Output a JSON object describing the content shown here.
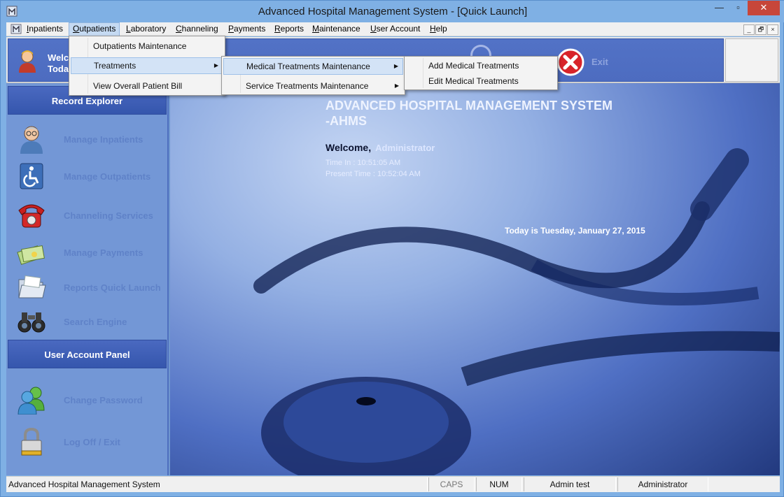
{
  "window": {
    "title": "Advanced Hospital Management System - [Quick Launch]",
    "controls": {
      "minimize": "—",
      "maximize": "▫",
      "close": "✕"
    }
  },
  "menubar": {
    "items": [
      {
        "label": "Inpatients",
        "accel": "I",
        "rest": "npatients"
      },
      {
        "label": "Outpatients",
        "accel": "O",
        "rest": "utpatients"
      },
      {
        "label": "Laboratory",
        "accel": "L",
        "rest": "aboratory"
      },
      {
        "label": "Channeling",
        "accel": "C",
        "rest": "hanneling"
      },
      {
        "label": "Payments",
        "accel": "P",
        "rest": "ayments"
      },
      {
        "label": "Reports",
        "accel": "R",
        "rest": "eports"
      },
      {
        "label": "Maintenance",
        "accel": "M",
        "rest": "aintenance"
      },
      {
        "label": "User Account",
        "accel": "U",
        "rest": "ser Account"
      },
      {
        "label": "Help",
        "accel": "H",
        "rest": "elp"
      }
    ],
    "mdi_controls": [
      "_",
      "🗗",
      "×"
    ]
  },
  "header": {
    "welcome_short_1": "Welco",
    "welcome_short_2": "Toda",
    "exit_label": "Exit"
  },
  "dropdowns": {
    "outpatients": [
      "Outpatients Maintenance",
      "Treatments",
      "View Overall Patient Bill"
    ],
    "treatments": [
      "Medical Treatments Maintenance",
      "Service Treatments Maintenance"
    ],
    "medical": [
      "Add Medical Treatments",
      "Edit Medical Treatments"
    ],
    "arrow": "▶"
  },
  "sidebar": {
    "record_heading": "Record Explorer",
    "record_items": [
      "Manage Inpatients",
      "Manage Outpatients",
      "Channeling Services",
      "Manage Payments",
      "Reports Quick Launch",
      "Search Engine"
    ],
    "account_heading": "User Account Panel",
    "account_items": [
      "Change Password",
      "Log Off / Exit"
    ]
  },
  "main": {
    "title_line1": "ADVANCED HOSPITAL MANAGEMENT SYSTEM",
    "title_line2": " -AHMS",
    "welcome_label": "Welcome,",
    "welcome_user": "Administrator",
    "time_in": "Time In :   10:51:05 AM",
    "present_time": "Present Time :  10:52:04 AM",
    "today": "Today is Tuesday, January 27, 2015"
  },
  "statusbar": {
    "app": "Advanced Hospital Management System",
    "caps": "CAPS",
    "num": "NUM",
    "user": "Admin test",
    "role": "Administrator"
  },
  "colors": {
    "title_bar": "#7fb0e4",
    "close_button": "#c7463a",
    "sidebar_heading": "#3556ad",
    "sidebar_bg": "#7397d6",
    "highlight": "#d3e3f6"
  }
}
